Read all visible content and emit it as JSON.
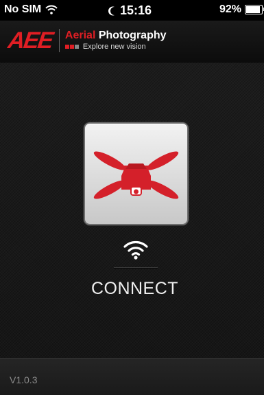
{
  "status_bar": {
    "carrier": "No SIM",
    "time": "15:16",
    "battery": "92%",
    "battery_level": 0.92
  },
  "header": {
    "logo_brand": "AEE",
    "logo_title_red": "Aerial",
    "logo_title_white": "Photography",
    "logo_tagline": "Explore new vision"
  },
  "main": {
    "connect_label": "CONNECT",
    "drone_icon": "quadcopter-drone-icon",
    "wifi_icon": "wifi-icon"
  },
  "footer": {
    "version": "V1.0.3"
  },
  "colors": {
    "brand_red": "#e01e24",
    "background": "#1a1a1a",
    "text": "#f0f0f0"
  }
}
